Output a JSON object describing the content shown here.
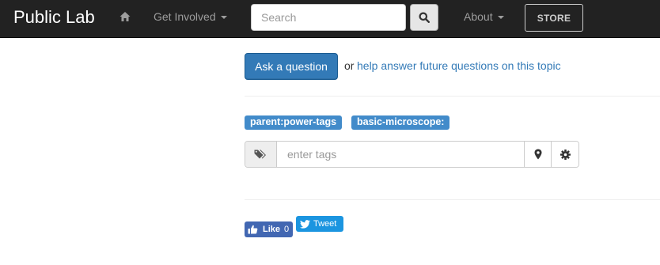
{
  "navbar": {
    "brand": "Public Lab",
    "home_icon": "home-icon",
    "get_involved_label": "Get Involved",
    "search": {
      "placeholder": "Search",
      "button_icon": "search-icon"
    },
    "about_label": "About",
    "store_label": "STORE"
  },
  "question": {
    "ask_button_label": "Ask a question",
    "or_text": "or",
    "help_link_text": "help answer future questions on this topic"
  },
  "tags": {
    "items": [
      "parent:power-tags",
      "basic-microscope:"
    ],
    "input_placeholder": "enter tags",
    "addon_icon": "tags-icon",
    "location_icon": "map-marker-icon",
    "settings_icon": "gear-icon"
  },
  "social": {
    "like_label": "Like",
    "like_count": "0",
    "tweet_label": "Tweet"
  },
  "colors": {
    "navbar_bg": "#222222",
    "primary": "#337ab7",
    "tag_bg": "#428bca",
    "facebook": "#4267b2",
    "twitter": "#1b95e0"
  }
}
